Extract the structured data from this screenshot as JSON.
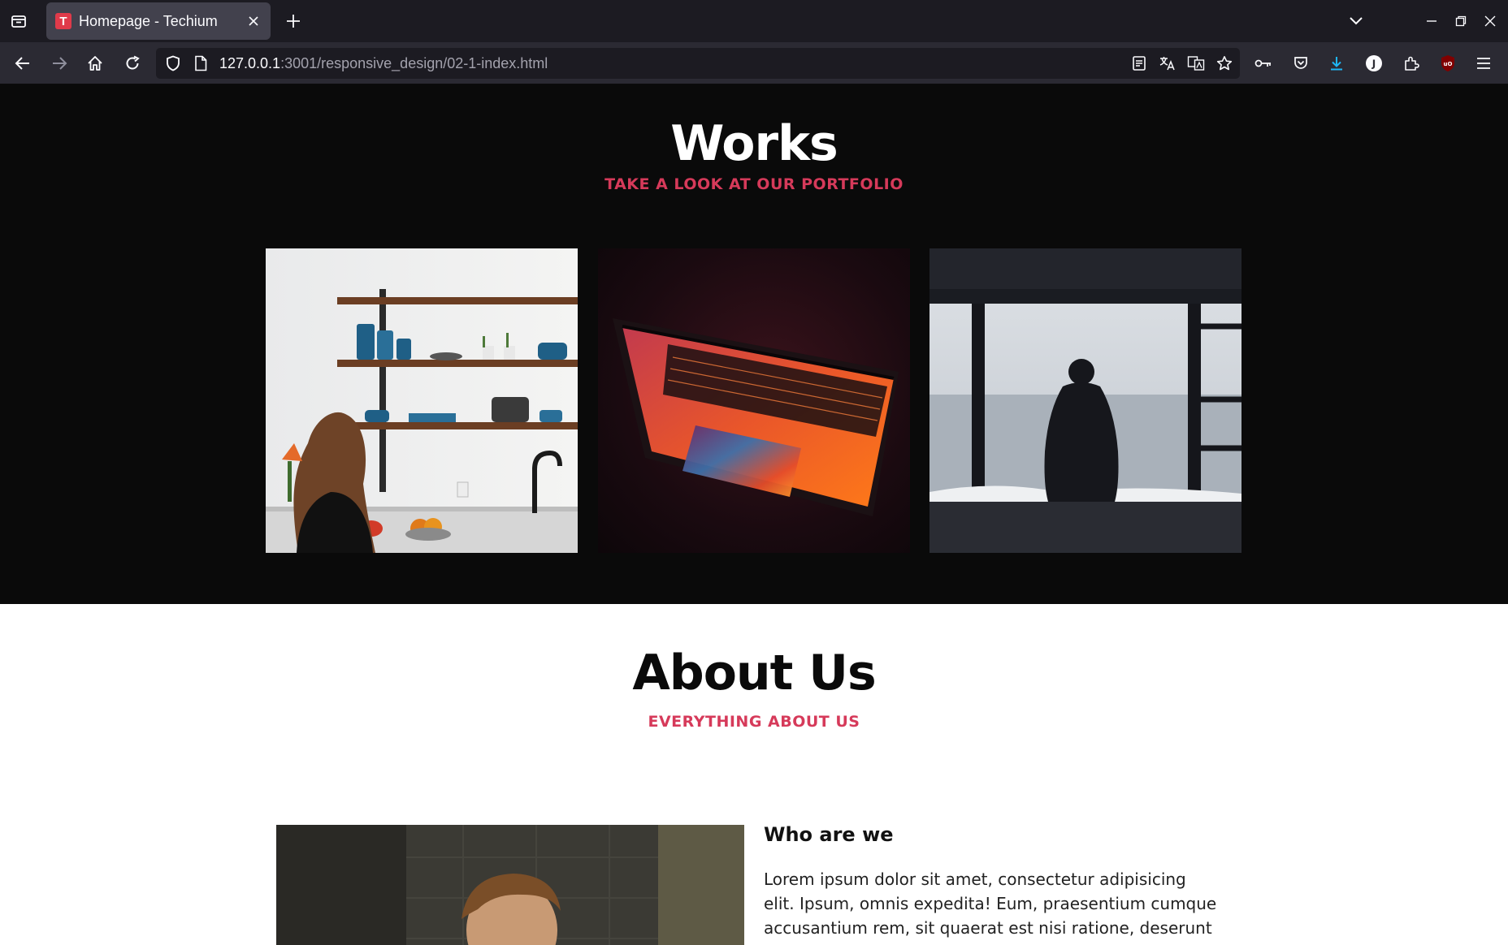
{
  "browser": {
    "tab_title": "Homepage - Techium",
    "favicon_letter": "T",
    "url_host": "127.0.0.1",
    "url_path": ":3001/responsive_design/02-1-index.html"
  },
  "works": {
    "title": "Works",
    "subtitle": "TAKE A LOOK AT OUR PORTFOLIO",
    "images": [
      {
        "subject": "kitchen shelves"
      },
      {
        "subject": "laptop"
      },
      {
        "subject": "person by the sea"
      }
    ]
  },
  "about": {
    "title": "About Us",
    "subtitle": "EVERYTHING ABOUT US",
    "heading": "Who are we",
    "paragraph": "Lorem ipsum dolor sit amet, consectetur adipisicing elit. Ipsum, omnis expedita! Eum, praesentium cumque accusantium rem, sit quaerat est nisi ratione, deserunt"
  },
  "colors": {
    "accent": "#d63a5a",
    "works_bg": "#0a0a0a",
    "chrome_dark": "#1c1b22",
    "chrome_toolbar": "#2b2a33"
  }
}
